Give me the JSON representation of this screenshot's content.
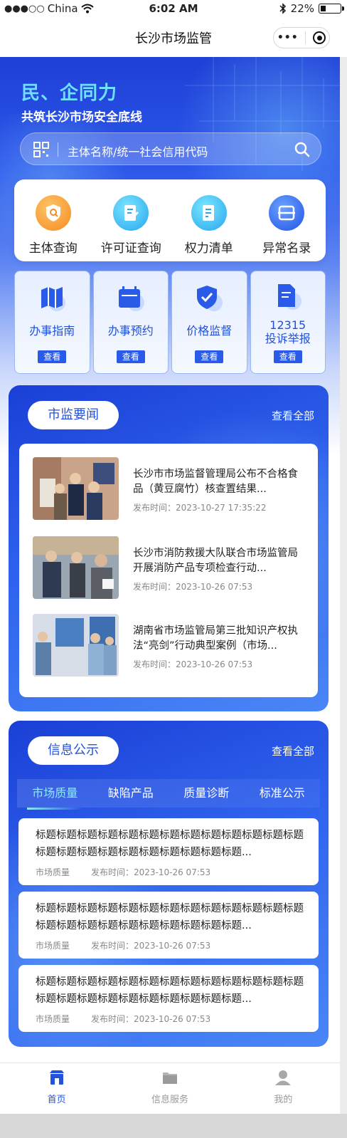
{
  "status_bar": {
    "carrier": "China",
    "time": "6:02 AM",
    "battery": "22%"
  },
  "nav": {
    "title": "长沙市场监管"
  },
  "hero": {
    "slogan_line1": "民、企同力",
    "slogan_line2": "共筑长沙市场安全底线",
    "search_placeholder": "主体名称/统一社会信用代码"
  },
  "quick_actions": [
    {
      "label": "主体查询",
      "icon": "shield-search-icon"
    },
    {
      "label": "许可证查询",
      "icon": "document-edit-icon"
    },
    {
      "label": "权力清单",
      "icon": "list-edit-icon"
    },
    {
      "label": "异常名录",
      "icon": "scan-icon"
    }
  ],
  "services": [
    {
      "label": "办事指南",
      "icon": "map-icon",
      "button": "查看"
    },
    {
      "label": "办事预约",
      "icon": "calendar-icon",
      "button": "查看"
    },
    {
      "label": "价格监督",
      "icon": "shield-check-icon",
      "button": "查看"
    },
    {
      "label_line1": "12315",
      "label_line2": "投诉举报",
      "icon": "report-icon",
      "button": "查看"
    }
  ],
  "news_section": {
    "title": "市监要闻",
    "more": "查看全部",
    "items": [
      {
        "title": "长沙市市场监督管理局公布不合格食品（黄豆腐竹）核查置结果...",
        "time": "发布时间：2023-10-27 17:35:22"
      },
      {
        "title": "长沙市消防救援大队联合市场监管局开展消防产品专项检查行动...",
        "time": "发布时间：2023-10-26 07:53"
      },
      {
        "title": "湖南省市场监管局第三批知识产权执法“亮剑”行动典型案例（市场...",
        "time": "发布时间：2023-10-26 07:53"
      }
    ]
  },
  "info_section": {
    "title": "信息公示",
    "more": "查看全部",
    "tabs": [
      "市场质量",
      "缺陷产品",
      "质量诊断",
      "标准公示"
    ],
    "items": [
      {
        "title": "标题标题标题标题标题标题标题标题标题标题标题标题标题标题标题标题标题标题标题标题标题标题标题...",
        "category": "市场质量",
        "time": "发布时间：2023-10-26 07:53"
      },
      {
        "title": "标题标题标题标题标题标题标题标题标题标题标题标题标题标题标题标题标题标题标题标题标题标题标题...",
        "category": "市场质量",
        "time": "发布时间：2023-10-26 07:53"
      },
      {
        "title": "标题标题标题标题标题标题标题标题标题标题标题标题标题标题标题标题标题标题标题标题标题标题标题...",
        "category": "市场质量",
        "time": "发布时间：2023-10-26 07:53"
      }
    ]
  },
  "tabbar": [
    {
      "label": "首页",
      "icon": "store-icon"
    },
    {
      "label": "信息服务",
      "icon": "folder-icon"
    },
    {
      "label": "我的",
      "icon": "user-icon"
    }
  ],
  "colors": {
    "primary": "#2352dc",
    "hero_accent": "#6fe0ff"
  }
}
